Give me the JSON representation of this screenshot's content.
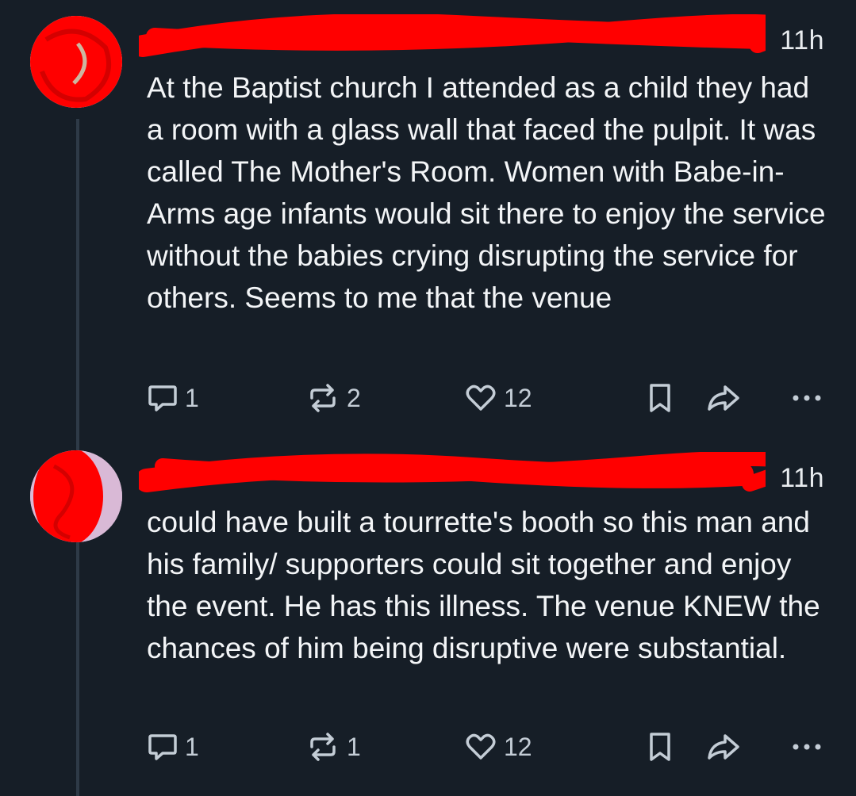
{
  "posts": [
    {
      "time": "11h",
      "text": "At the Baptist church I attended as a child they had a room with a glass wall that faced the pulpit. It was called The Mother's Room. Women with Babe-in-Arms age infants would sit there to enjoy the service without the babies crying disrupting the service for others. Seems to me that the venue",
      "replies": "1",
      "reposts": "2",
      "likes": "12"
    },
    {
      "time": "11h",
      "text": "could have built a tourrette's booth so this man and his family/ supporters could sit together and enjoy the event. He has this illness. The venue KNEW the chances of him being disruptive were substantial.",
      "replies": "1",
      "reposts": "1",
      "likes": "12"
    }
  ],
  "icons": {
    "reply": "reply-bubble-icon",
    "repost": "repost-arrows-icon",
    "like": "heart-icon",
    "bookmark": "bookmark-icon",
    "share": "share-arrow-icon",
    "more": "more-dots-icon"
  },
  "colors": {
    "background": "#161e27",
    "text": "#f3f5f7",
    "muted": "#c4cdd6",
    "redaction": "#ff0000",
    "thread_line": "#2e3a47"
  }
}
